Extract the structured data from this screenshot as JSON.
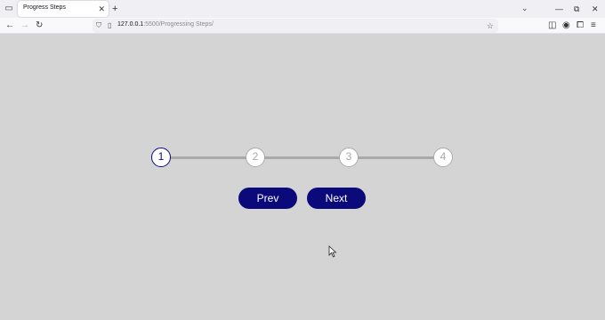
{
  "browser": {
    "tab": {
      "title": "Progress Steps",
      "close_icon": "close-icon"
    },
    "new_tab_label": "+",
    "url_host": "127.0.0.1",
    "url_path": ":5500/Progressing Steps/",
    "window_controls": {
      "minimize": "—",
      "restore": "⧉",
      "close": "✕"
    }
  },
  "progress": {
    "steps": [
      "1",
      "2",
      "3",
      "4"
    ],
    "active_count": 1,
    "fill_fraction": 0,
    "accent_color": "#0b0a7a",
    "inactive_color": "#a9a9a9"
  },
  "buttons": {
    "prev_label": "Prev",
    "next_label": "Next"
  }
}
